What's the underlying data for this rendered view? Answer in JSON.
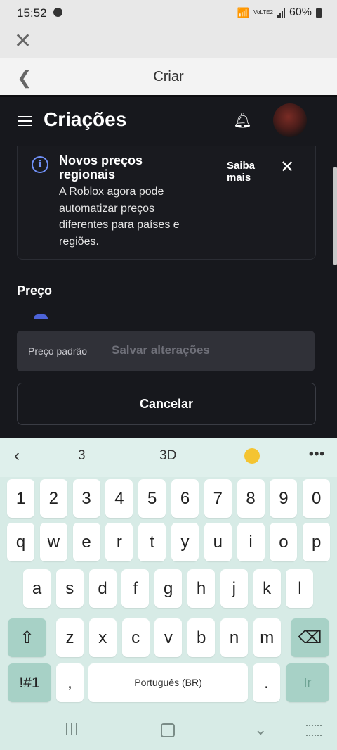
{
  "status_bar": {
    "time": "15:52",
    "network": "VoLTE2",
    "battery": "60%"
  },
  "close_bar": {
    "close_icon": "close-icon"
  },
  "nav_bar": {
    "title": "Criar",
    "back_icon": "chevron-left-icon"
  },
  "app": {
    "page_title": "Criações",
    "banner": {
      "title": "Novos preços regionais",
      "text": "A Roblox agora pode automatizar preços diferentes para países e regiões.",
      "learn_more": "Saiba mais"
    },
    "section_title": "Preço",
    "price_field_label": "Preço padrão",
    "save_label": "Salvar alterações",
    "cancel_label": "Cancelar"
  },
  "keyboard": {
    "suggestions": [
      "3",
      "3D"
    ],
    "number_row": [
      "1",
      "2",
      "3",
      "4",
      "5",
      "6",
      "7",
      "8",
      "9",
      "0"
    ],
    "row1": [
      "q",
      "w",
      "e",
      "r",
      "t",
      "y",
      "u",
      "i",
      "o",
      "p"
    ],
    "row2": [
      "a",
      "s",
      "d",
      "f",
      "g",
      "h",
      "j",
      "k",
      "l"
    ],
    "row3": [
      "z",
      "x",
      "c",
      "v",
      "b",
      "n",
      "m"
    ],
    "symbols_label": "!#1",
    "comma": ",",
    "space_label": "Português (BR)",
    "period": ".",
    "go_label": "Ir"
  }
}
